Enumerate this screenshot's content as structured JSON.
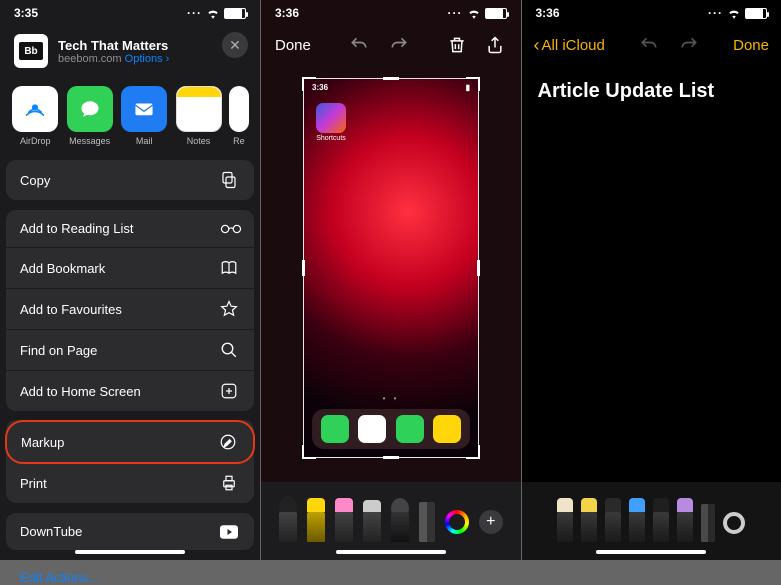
{
  "screen1": {
    "status_time": "3:35",
    "share_title": "Tech That Matters",
    "share_sub_domain": "beebom.com",
    "share_options": "Options",
    "share_options_arrow": "›",
    "thumb_text": "Bb",
    "apps": {
      "airdrop": "AirDrop",
      "messages": "Messages",
      "mail": "Mail",
      "notes": "Notes",
      "reminders": "Re"
    },
    "actions": {
      "copy": "Copy",
      "reading_list": "Add to Reading List",
      "bookmark": "Add Bookmark",
      "favourites": "Add to Favourites",
      "find": "Find on Page",
      "home_screen": "Add to Home Screen",
      "markup": "Markup",
      "print": "Print",
      "downtube": "DownTube"
    },
    "edit_actions": "Edit Actions..."
  },
  "screen2": {
    "status_time": "3:36",
    "done": "Done",
    "mini_time": "3:36",
    "shortcuts_label": "Shortcuts",
    "plus": "+"
  },
  "screen3": {
    "status_time": "3:36",
    "back_label": "All iCloud",
    "done": "Done",
    "note_title": "Article Update List"
  }
}
